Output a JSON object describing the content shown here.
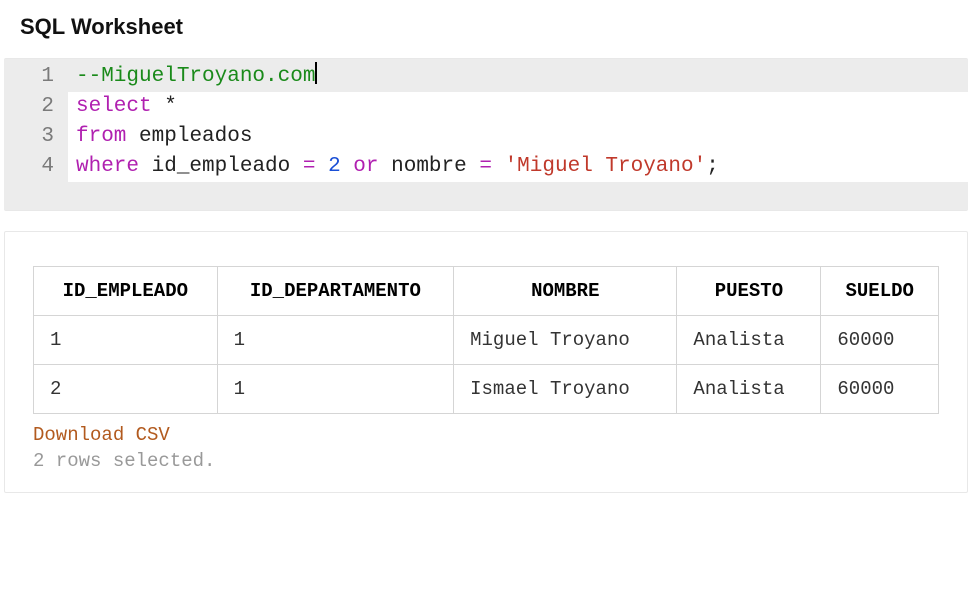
{
  "header": {
    "title": "SQL Worksheet"
  },
  "editor": {
    "lines": [
      {
        "num": "1",
        "tokens": [
          {
            "cls": "tok-comment",
            "t": "--MiguelTroyano.com"
          }
        ],
        "active": true,
        "cursor_after": true
      },
      {
        "num": "2",
        "tokens": [
          {
            "cls": "tok-keyword",
            "t": "select"
          },
          {
            "cls": "",
            "t": " "
          },
          {
            "cls": "tok-star",
            "t": "*"
          }
        ]
      },
      {
        "num": "3",
        "tokens": [
          {
            "cls": "tok-keyword",
            "t": "from"
          },
          {
            "cls": "",
            "t": " "
          },
          {
            "cls": "tok-ident",
            "t": "empleados"
          }
        ]
      },
      {
        "num": "4",
        "tokens": [
          {
            "cls": "tok-keyword",
            "t": "where"
          },
          {
            "cls": "",
            "t": " "
          },
          {
            "cls": "tok-ident",
            "t": "id_empleado"
          },
          {
            "cls": "",
            "t": " "
          },
          {
            "cls": "tok-operator",
            "t": "="
          },
          {
            "cls": "",
            "t": " "
          },
          {
            "cls": "tok-number",
            "t": "2"
          },
          {
            "cls": "",
            "t": " "
          },
          {
            "cls": "tok-keyword",
            "t": "or"
          },
          {
            "cls": "",
            "t": " "
          },
          {
            "cls": "tok-ident",
            "t": "nombre"
          },
          {
            "cls": "",
            "t": " "
          },
          {
            "cls": "tok-operator",
            "t": "="
          },
          {
            "cls": "",
            "t": " "
          },
          {
            "cls": "tok-string",
            "t": "'Miguel Troyano'"
          },
          {
            "cls": "tok-ident",
            "t": ";"
          }
        ]
      }
    ]
  },
  "results": {
    "columns": [
      "ID_EMPLEADO",
      "ID_DEPARTAMENTO",
      "NOMBRE",
      "PUESTO",
      "SUELDO"
    ],
    "rows": [
      [
        "1",
        "1",
        "Miguel Troyano",
        "Analista",
        "60000"
      ],
      [
        "2",
        "1",
        "Ismael Troyano",
        "Analista",
        "60000"
      ]
    ],
    "download_label": "Download CSV",
    "status": "2 rows selected."
  }
}
